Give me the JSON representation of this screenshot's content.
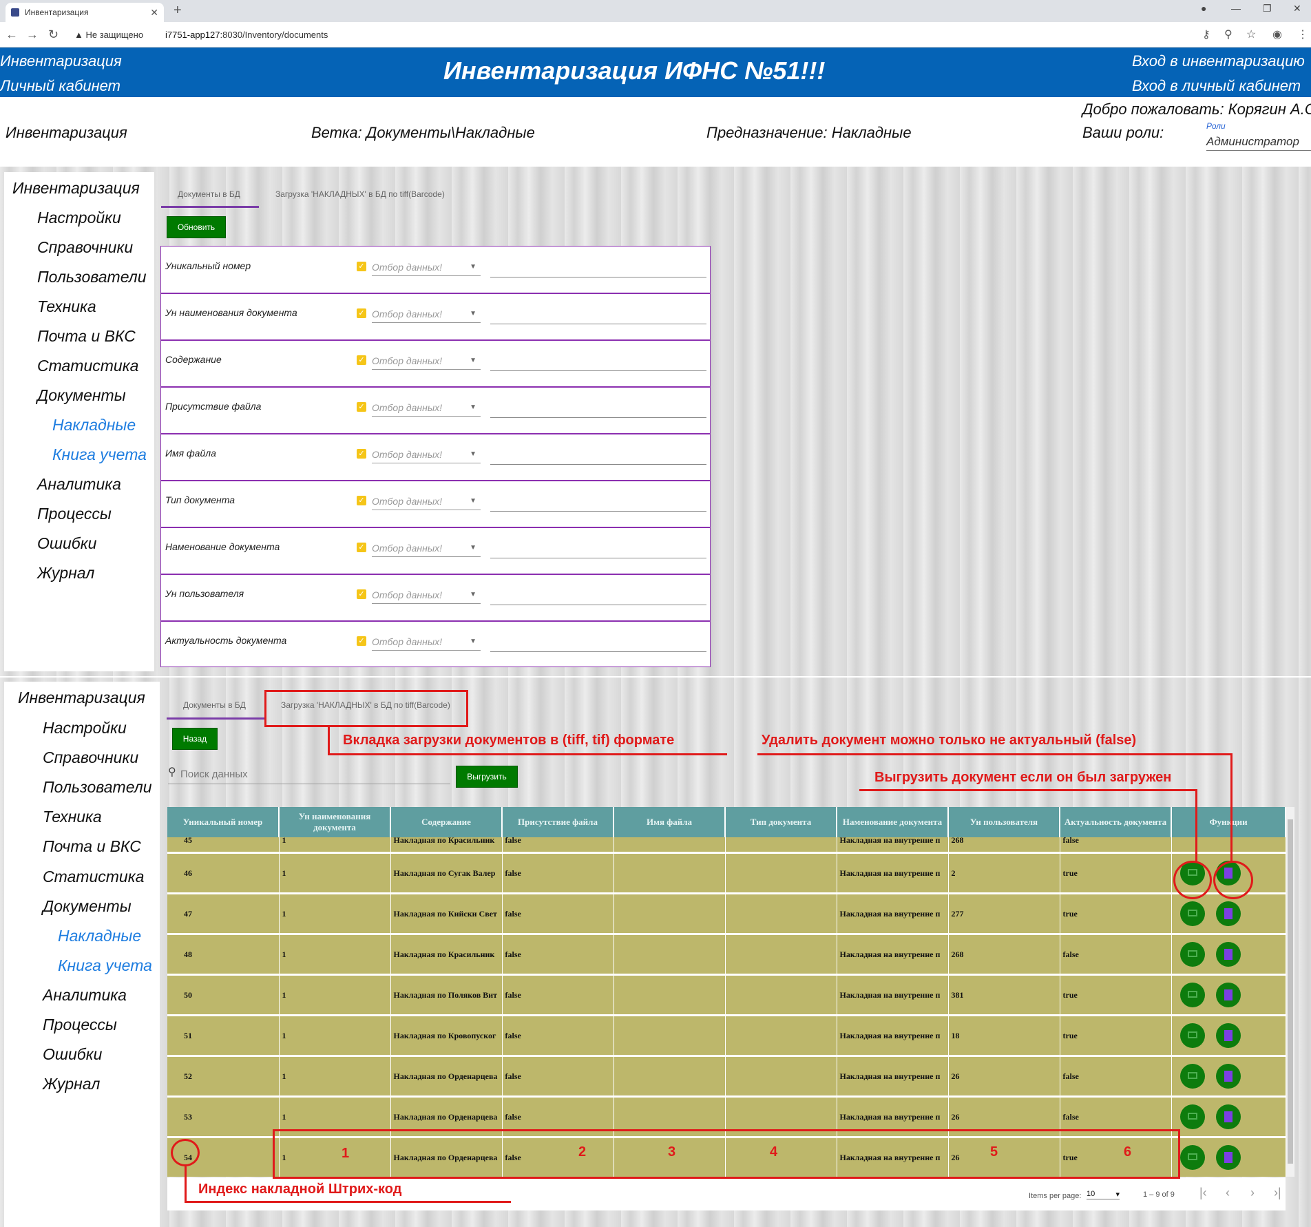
{
  "browser": {
    "tab_title": "Инвентаризация",
    "security": "Не защищено",
    "url_host": "i7751-app127",
    "url_rest": ":8030/Inventory/documents"
  },
  "header": {
    "left_line1": "Инвентаризация",
    "left_line2": "Личный кабинет",
    "title": "Инвентаризация ИФНС №51!!!",
    "right_line1": "Вход в инвентаризацию",
    "right_line2": "Вход в личный кабинет"
  },
  "subheader": {
    "section": "Инвентаризация",
    "branch": "Ветка: Документы\\Накладные",
    "purpose": "Предназначение: Накладные",
    "welcome": "Добро пожаловать: Корягин А.С.",
    "roles_label": "Ваши роли:",
    "roles_small": "Роли",
    "roles_value": "Администратор"
  },
  "sidebar": {
    "items": [
      "Инвентаризация",
      "Настройки",
      "Справочники",
      "Пользователи",
      "Техника",
      "Почта и ВКС",
      "Статистика",
      "Документы",
      "Накладные",
      "Книга учета",
      "Аналитика",
      "Процессы",
      "Ошибки",
      "Журнал"
    ]
  },
  "tabs": {
    "docs": "Документы в БД",
    "upload": "Загрузка 'НАКЛАДНЫХ' в БД по tiff(Barcode)"
  },
  "buttons": {
    "refresh": "Обновить",
    "back": "Назад",
    "upload": "Выгрузить"
  },
  "filters": {
    "placeholder": "Отбор данных!",
    "rows": [
      "Уникальный номер",
      "Ун наименования документа",
      "Содержание",
      "Присутствие файла",
      "Имя файла",
      "Тип документа",
      "Наменование документа",
      "Ун пользователя",
      "Актуальность документа"
    ]
  },
  "search": {
    "placeholder": "Поиск данных"
  },
  "table": {
    "headers": [
      "Уникальный номер",
      "Ун наименования документа",
      "Содержание",
      "Присутствие файла",
      "Имя файла",
      "Тип документа",
      "Наменование документа",
      "Ун пользователя",
      "Актуальность документа",
      "Функции"
    ],
    "partial_row": [
      "45",
      "1",
      "Накладная по Красильник",
      "false",
      "",
      "",
      "Накладная на внутренне п",
      "268",
      "false"
    ],
    "rows": [
      [
        "46",
        "1",
        "Накладная по Сугак Валер",
        "false",
        "",
        "",
        "Накладная на внутренне п",
        "2",
        "true"
      ],
      [
        "47",
        "1",
        "Накладная по Кийски Свет",
        "false",
        "",
        "",
        "Накладная на внутренне п",
        "277",
        "true"
      ],
      [
        "48",
        "1",
        "Накладная по Красильник",
        "false",
        "",
        "",
        "Накладная на внутренне п",
        "268",
        "false"
      ],
      [
        "50",
        "1",
        "Накладная по Поляков Вит",
        "false",
        "",
        "",
        "Накладная на внутренне п",
        "381",
        "true"
      ],
      [
        "51",
        "1",
        "Накладная по Кровопуског",
        "false",
        "",
        "",
        "Накладная на внутренне п",
        "18",
        "true"
      ],
      [
        "52",
        "1",
        "Накладная по Орденарцева",
        "false",
        "",
        "",
        "Накладная на внутренне п",
        "26",
        "false"
      ],
      [
        "53",
        "1",
        "Накладная по Орденарцева",
        "false",
        "",
        "",
        "Накладная на внутренне п",
        "26",
        "false"
      ],
      [
        "54",
        "1",
        "Накладная по Орденарцева",
        "false",
        "",
        "",
        "Накладная на внутренне п",
        "26",
        "true"
      ]
    ]
  },
  "paginator": {
    "items_per_page_label": "Items per page:",
    "items_per_page": "10",
    "range": "1 – 9 of 9"
  },
  "annotations": {
    "upload_tab_note": "Вкладка загрузки документов в (tiff, tif) формате",
    "delete_note": "Удалить документ можно только не актуальный (false)",
    "download_note": "Выгрузить документ если он был загружен",
    "barcode_note": "Индекс накладной Штрих-код",
    "numbers": [
      "1",
      "2",
      "3",
      "4",
      "5",
      "6"
    ]
  },
  "colors": {
    "header_blue": "#0563b6",
    "table_header": "#5f9ea0",
    "table_cell": "#bdb76b",
    "green_button": "#007a00",
    "annotation_red": "#e01a1a",
    "filter_border": "#8b2fb0"
  }
}
